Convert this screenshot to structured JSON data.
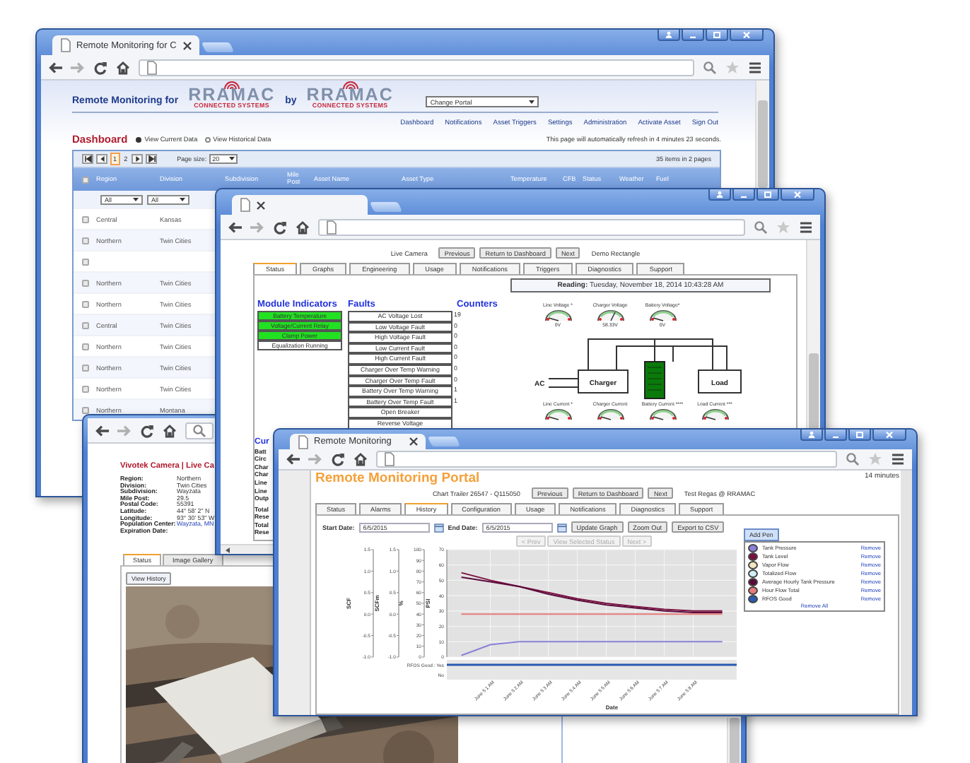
{
  "dashboard_window": {
    "tab_title": "Remote Monitoring for C",
    "header": {
      "label": "Remote Monitoring for",
      "joiner": "by",
      "logos": [
        {
          "name": "RRAMAC",
          "tagline": "CONNECTED SYSTEMS"
        },
        {
          "name": "RRAMAC",
          "tagline": "CONNECTED SYSTEMS"
        }
      ],
      "portal_select": "Change Portal"
    },
    "nav_links": [
      "Dashboard",
      "Notifications",
      "Asset Triggers",
      "Settings",
      "Administration",
      "Activate Asset",
      "Sign Out"
    ],
    "title": "Dashboard",
    "view_options": [
      {
        "label": "View Current Data",
        "selected": true
      },
      {
        "label": "View Historical Data",
        "selected": false
      }
    ],
    "refresh_notice": "This page will automatically refresh in 4 minutes 23 seconds.",
    "pager": {
      "pages": [
        {
          "label": "1",
          "selected": true
        },
        {
          "label": "2",
          "selected": false
        }
      ],
      "page_size_label": "Page size:",
      "page_size": "20",
      "summary": "35 items in 2 pages"
    },
    "all_checked": false,
    "columns": [
      "Region",
      "Division",
      "Subdivision",
      "Mile Post",
      "Asset Name",
      "Asset Type",
      "Temperature",
      "CFB",
      "Status",
      "Weather",
      "Fuel"
    ],
    "filters": [
      "All",
      "All"
    ],
    "rows": [
      {
        "kind": "data",
        "checked": false,
        "region": "Central",
        "division": "Kansas"
      },
      {
        "kind": "data",
        "checked": false,
        "region": "Northern",
        "division": "Twin Cities"
      },
      {
        "kind": "blank",
        "checked": false
      },
      {
        "kind": "data",
        "checked": false,
        "region": "Northern",
        "division": "Twin Cities"
      },
      {
        "kind": "data",
        "checked": false,
        "region": "Northern",
        "division": "Twin Cities"
      },
      {
        "kind": "data",
        "checked": false,
        "region": "Central",
        "division": "Twin Cities"
      },
      {
        "kind": "data",
        "checked": false,
        "region": "Northern",
        "division": "Twin Cities"
      },
      {
        "kind": "data",
        "checked": false,
        "region": "Northern",
        "division": "Twin Cities"
      },
      {
        "kind": "data",
        "checked": false,
        "region": "Northern",
        "division": "Twin Cities"
      },
      {
        "kind": "data",
        "checked": false,
        "region": "Northern",
        "division": "Montana"
      }
    ]
  },
  "camera_window": {
    "title": "Vivotek Camera | Live Ca",
    "details": [
      {
        "label": "Region:",
        "value": "Northern"
      },
      {
        "label": "Division:",
        "value": "Twin Cities"
      },
      {
        "label": "Subdivision:",
        "value": "Wayzata"
      },
      {
        "label": "Mile Post:",
        "value": "29.5"
      },
      {
        "label": "Postal Code:",
        "value": "55391"
      },
      {
        "label": "Latitude:",
        "value": "44° 58' 2\" N"
      },
      {
        "label": "Longitude:",
        "value": "93° 30' 53\" W"
      },
      {
        "label": "Population Center:",
        "value": "Wayzata, MN",
        "kind": "link"
      },
      {
        "label": "Expiration Date:"
      }
    ],
    "tabs": [
      {
        "label": "Status",
        "selected": true
      },
      {
        "label": "Image Gallery",
        "selected": false
      }
    ],
    "history_button": "View History"
  },
  "status_window": {
    "asset_bar": {
      "label": "Live Camera",
      "buttons": [
        "Previous",
        "Return to Dashboard",
        "Next"
      ],
      "asset": "Demo Rectangle"
    },
    "tabs": [
      {
        "label": "Status",
        "selected": true
      },
      {
        "label": "Graphs",
        "selected": false
      },
      {
        "label": "Engineering",
        "selected": false
      },
      {
        "label": "Usage",
        "selected": false
      },
      {
        "label": "Notifications",
        "selected": false
      },
      {
        "label": "Triggers",
        "selected": false
      },
      {
        "label": "Diagnostics",
        "selected": false
      },
      {
        "label": "Support",
        "selected": false
      }
    ],
    "reading": "**Reading:** Tuesday, November 18, 2014 10:43:28 AM",
    "indicators_title": "Module Indicators",
    "indicators": [
      {
        "label": "Battery Temperature",
        "on": true
      },
      {
        "label": "Voltage/Current Relay",
        "on": true
      },
      {
        "label": "Clamp Power",
        "on": true
      },
      {
        "label": "Equalization Running",
        "on": false
      }
    ],
    "faults_title": "Faults",
    "counters_title": "Counters",
    "faults": [
      {
        "label": "AC Voltage Lost",
        "count": "19"
      },
      {
        "label": "Low Voltage Fault",
        "count": "0"
      },
      {
        "label": "High Voltage Fault",
        "count": "0"
      },
      {
        "label": "Low Current Fault",
        "count": "0"
      },
      {
        "label": "High Current Fault",
        "count": "0"
      },
      {
        "label": "Charger Over Temp Warning",
        "count": "0"
      },
      {
        "label": "Charger Over Temp Fault",
        "count": "0"
      },
      {
        "label": "Battery Over Temp Warning",
        "count": "1"
      },
      {
        "label": "Battery Over Temp Fault",
        "count": "1"
      },
      {
        "label": "Open Breaker"
      },
      {
        "label": "Reverse Voltage"
      }
    ],
    "top_gauges": [
      {
        "label": "Line Voltage *",
        "reading": "0V"
      },
      {
        "label": "Charger Voltage",
        "reading": "58.33V"
      },
      {
        "label": "Battery Voltage*",
        "reading": "0V"
      }
    ],
    "diagram": {
      "source": "AC",
      "charger": "Charger",
      "load": "Load"
    },
    "bottom_gauges": [
      {
        "label": "Line Current *"
      },
      {
        "label": "Charger Current"
      },
      {
        "label": "Battery Current ****"
      },
      {
        "label": "Load Current ***"
      }
    ],
    "current_section": {
      "title": "Cur",
      "lines": [
        "Batt",
        "Circ",
        "Char",
        "Char",
        "Line",
        "Line",
        "Outp"
      ],
      "totals": [
        "Total",
        "Rese",
        "Total",
        "Rese"
      ]
    }
  },
  "history_window": {
    "tab_title": "Remote Monitoring",
    "portal_title": "Remote Monitoring Portal",
    "session_note": "14 minutes",
    "asset_bar": {
      "label": "Chart Trailer 26547 - Q115050",
      "buttons": [
        "Previous",
        "Return to Dashboard",
        "Next"
      ],
      "user": "Test Regas @ RRAMAC"
    },
    "tabs": [
      {
        "label": "Status",
        "selected": false
      },
      {
        "label": "Alarms",
        "selected": false
      },
      {
        "label": "History",
        "selected": true
      },
      {
        "label": "Configuration",
        "selected": false
      },
      {
        "label": "Usage",
        "selected": false
      },
      {
        "label": "Notifications",
        "selected": false
      },
      {
        "label": "Diagnostics",
        "selected": false
      },
      {
        "label": "Support",
        "selected": false
      }
    ],
    "date_range": {
      "start_label": "Start Date:",
      "start": "6/5/2015",
      "end_label": "End Date:",
      "end": "6/5/2015",
      "buttons": [
        "Update Graph",
        "Zoom Out",
        "Export to CSV"
      ]
    },
    "status_nav": [
      {
        "label": "< Prev",
        "disabled": true
      },
      {
        "label": "View Selected Status",
        "disabled": true
      },
      {
        "label": "Next >",
        "disabled": true
      }
    ],
    "extra_axes": [
      {
        "label": "SCF",
        "ticks": [
          "1.5",
          "1.0",
          "0.5",
          "0.0",
          "-0.5",
          "-1.0"
        ]
      },
      {
        "label": "SCFm",
        "ticks": [
          "1.5",
          "1.0",
          "0.5",
          "0.0",
          "-0.5",
          "-1.0"
        ]
      },
      {
        "label": "%",
        "ticks": [
          "100",
          "90",
          "80",
          "70",
          "60",
          "50",
          "40",
          "30",
          "20",
          "10",
          "0"
        ]
      }
    ],
    "status_band": {
      "yes": "RFOS Good : Yes",
      "no": "No"
    },
    "chart_data": {
      "type": "line",
      "grid": true,
      "xlabel": "Date",
      "ylabel": "PSI",
      "ylim": [
        0,
        70
      ],
      "yticks": [
        0,
        10,
        20,
        30,
        40,
        50,
        60,
        70
      ],
      "categories": [
        null,
        "June 5 1 AM",
        "June 5 2 AM",
        "June 5 3 AM",
        "June 5 4 AM",
        "June 5 5 AM",
        "June 5 6 AM",
        "June 5 7 AM",
        "June 5 8 AM",
        null
      ],
      "series": [
        {
          "name": "Tank Pressure",
          "color": "#8a80d8",
          "values": [
            1,
            8,
            10,
            10,
            10,
            10,
            10,
            10,
            10,
            10
          ]
        },
        {
          "name": "Tank Level",
          "color": "#7a1040",
          "values": [
            55,
            50,
            46,
            42,
            38,
            35,
            33,
            31,
            30,
            30
          ]
        },
        {
          "name": "Vapor Flow",
          "color": "#f5e6c0",
          "values": [
            null,
            null,
            null,
            null,
            null,
            null,
            null,
            null,
            null,
            null
          ]
        },
        {
          "name": "Totalized Flow",
          "color": "#cfeff5",
          "values": [
            null,
            null,
            null,
            null,
            null,
            null,
            null,
            null,
            null,
            null
          ]
        },
        {
          "name": "Average Hourly Tank Pressure",
          "color": "#5a0a3a",
          "values": [
            52,
            49,
            46,
            41,
            37,
            34,
            32,
            30,
            29,
            29
          ]
        },
        {
          "name": "Hour Flow Total",
          "color": "#e87a7a",
          "values": [
            28,
            28,
            28,
            28,
            28,
            28,
            28,
            28,
            28,
            28
          ]
        },
        {
          "name": "RFOS Good",
          "color": "#2a5ab0",
          "values": [
            null,
            null,
            null,
            null,
            null,
            null,
            null,
            null,
            null,
            null
          ]
        }
      ]
    },
    "pens": {
      "add": "Add Pen",
      "remove_all": "Remove All",
      "actions": [
        "Remove",
        "Remove",
        "Remove",
        "Remove",
        "Remove",
        "Remove",
        "Remove"
      ]
    }
  }
}
